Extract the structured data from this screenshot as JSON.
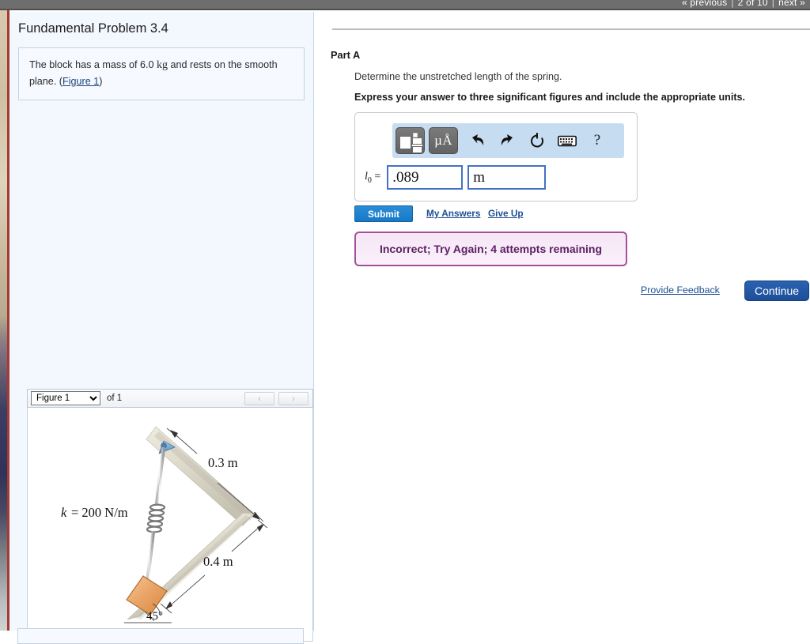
{
  "topbar": {
    "previous_label": "« previous",
    "position_label": "2 of 10",
    "next_label": "next »",
    "separator": "|"
  },
  "left_panel": {
    "problem_title": "Fundamental Problem 3.4",
    "statement_part1": "The block has a mass of 6.0 ",
    "statement_units": "kg",
    "statement_part2": " and rests on the smooth plane. (",
    "figure_link": "Figure 1",
    "statement_part3": ")"
  },
  "figure_panel": {
    "selected_figure": "Figure 1",
    "options": [
      "Figure 1"
    ],
    "count_label": "of 1",
    "prev_label": "‹",
    "next_label": "›",
    "diagram": {
      "spring_constant_label": "k = 200 N/m",
      "top_length_label": "0.3 m",
      "bottom_length_label": "0.4 m",
      "angle_label": "45°",
      "block_color": "#e8a468",
      "plane_color": "#dcd8c8",
      "pin_color": "#6fa8d4"
    }
  },
  "right_panel": {
    "part_label": "Part A",
    "question": "Determine the unstretched length of the spring.",
    "instruction": "Express your answer to three significant figures and include the appropriate units.",
    "answer": {
      "label": "l0 =",
      "label_base": "l",
      "label_sub": "0",
      "label_eq": "=",
      "value": ".089",
      "value_placeholder": "",
      "unit": "m",
      "unit_placeholder": ""
    },
    "toolbar": {
      "template_icon": "template-icon",
      "units_icon": "µÅ",
      "undo_icon": "undo-icon",
      "redo_icon": "redo-icon",
      "reset_icon": "reset-icon",
      "keyboard_icon": "keyboard-icon",
      "help_icon": "?"
    },
    "submit_label": "Submit",
    "my_answers_label": "My Answers",
    "give_up_label": "Give Up",
    "feedback_message": "Incorrect; Try Again; 4 attempts remaining",
    "provide_feedback_label": "Provide Feedback",
    "continue_label": "Continue"
  },
  "colors": {
    "submit_blue": "#1779c8",
    "continue_blue": "#1e4f99",
    "link_blue": "#1d4f91",
    "feedback_border": "#a3509c",
    "feedback_text": "#5b1f62",
    "panel_bg": "#f3f7fe",
    "toolbar_bg": "#c6dcf0",
    "topbar_gray": "#6e6e6e"
  }
}
